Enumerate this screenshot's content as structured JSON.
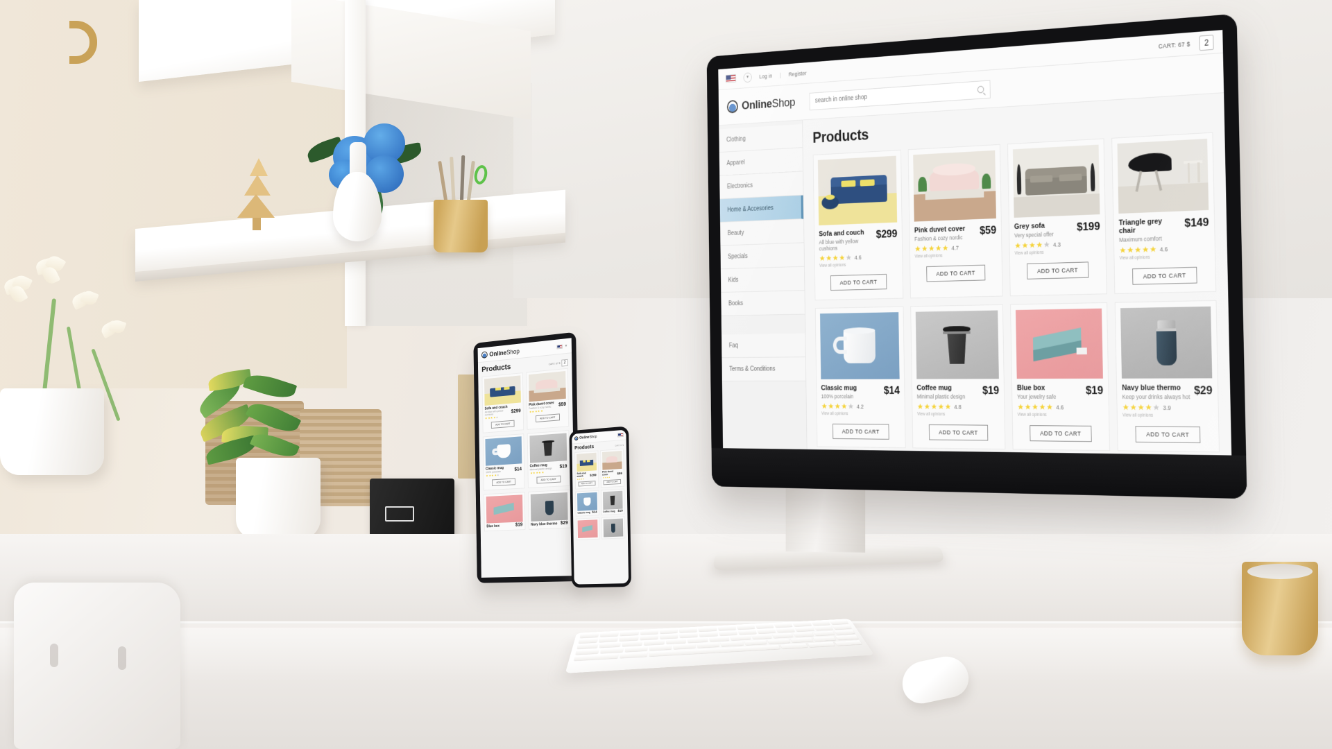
{
  "site": {
    "logo": {
      "bold": "Online",
      "light": "Shop",
      "icon": "circle-logo-icon"
    },
    "topbar": {
      "flag": "us-flag-icon",
      "language_chevron": "chevron-down-icon",
      "login": "Log in",
      "separator": "|",
      "register": "Register",
      "cart_label": "CART: 67 $",
      "cart_count": "2"
    },
    "search": {
      "placeholder": "search in online shop",
      "value": "",
      "icon": "search-icon"
    },
    "sidebar": {
      "items": [
        {
          "label": "Clothing",
          "active": false
        },
        {
          "label": "Apparel",
          "active": false
        },
        {
          "label": "Electronics",
          "active": false
        },
        {
          "label": "Home & Accesories",
          "active": true
        },
        {
          "label": "Beauty",
          "active": false
        },
        {
          "label": "Specials",
          "active": false
        },
        {
          "label": "Kids",
          "active": false
        },
        {
          "label": "Books",
          "active": false
        }
      ],
      "footer_items": [
        {
          "label": "Faq"
        },
        {
          "label": "Terms & Conditions"
        }
      ]
    },
    "main": {
      "title": "Products",
      "add_to_cart_label": "ADD TO CART",
      "opinions_label": "View all opinions",
      "products": [
        {
          "name": "Sofa and couch",
          "desc": "All blue with yellow cushions",
          "price": "$299",
          "rating": "4.6",
          "stars": 5,
          "art": "a-sofa"
        },
        {
          "name": "Pink duvet cover",
          "desc": "Fashion & cozy nordic",
          "price": "$59",
          "rating": "4.7",
          "stars": 5,
          "art": "a-duvet"
        },
        {
          "name": "Grey sofa",
          "desc": "Very special offer",
          "price": "$199",
          "rating": "4.3",
          "stars": 4,
          "art": "a-grey"
        },
        {
          "name": "Triangle grey chair",
          "desc": "Maximum comfort",
          "price": "$149",
          "rating": "4.6",
          "stars": 5,
          "art": "a-chair"
        },
        {
          "name": "Classic mug",
          "desc": "100% porcelain",
          "price": "$14",
          "rating": "4.2",
          "stars": 4,
          "art": "a-mug"
        },
        {
          "name": "Coffee mug",
          "desc": "Minimal plastic design",
          "price": "$19",
          "rating": "4.8",
          "stars": 5,
          "art": "a-coffee"
        },
        {
          "name": "Blue box",
          "desc": "Your jewelry safe",
          "price": "$19",
          "rating": "4.6",
          "stars": 5,
          "art": "a-box"
        },
        {
          "name": "Navy blue thermo",
          "desc": "Keep your drinks always hot",
          "price": "$29",
          "rating": "3.9",
          "stars": 4,
          "art": "a-thermo"
        }
      ]
    }
  },
  "colors": {
    "accent_blue": "#a9cee4",
    "star_gold": "#f5d33a",
    "star_grey": "#c9c9c9",
    "price_text": "#171717",
    "bezel": "#111113"
  },
  "devices": {
    "desktop": "imac-desktop-monitor",
    "tablet": "tablet-device",
    "phone": "phone-device"
  },
  "scene": {
    "keyboard": "white-keyboard",
    "mouse": "white-mouse",
    "mug": "gold-mug",
    "chair": "white-chair",
    "plant_left": "white-orchid-plant",
    "plant_croton": "croton-potted-plant",
    "flowers": "blue-hydrangea-bouquet",
    "pencil_cup": "gold-pencil-cup",
    "wood_tree": "wooden-tree-decoration",
    "basket_a": "wicker-basket",
    "basket_b": "wicker-basket",
    "black_box": "black-storage-box",
    "books": "book-stack"
  }
}
